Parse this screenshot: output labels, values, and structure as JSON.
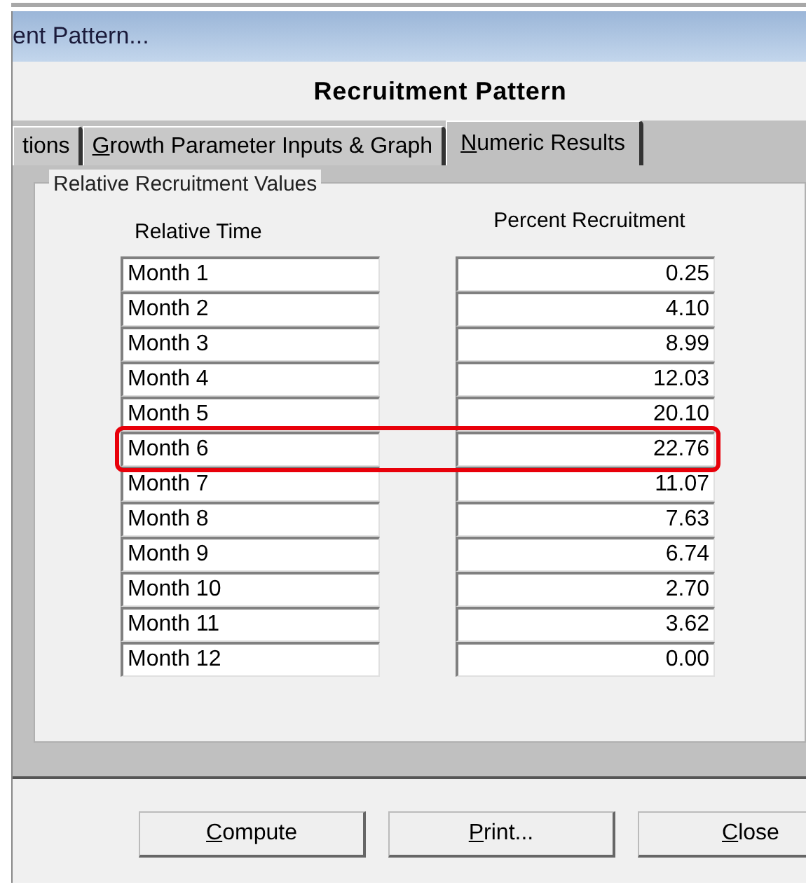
{
  "window": {
    "title": "ent Pattern..."
  },
  "header": "Recruitment Pattern",
  "tabs": [
    {
      "label": "tions",
      "selected": false,
      "underline_first": false
    },
    {
      "label": "Growth Parameter Inputs & Graph",
      "selected": false,
      "underline_first": true
    },
    {
      "label": "Numeric Results",
      "selected": true,
      "underline_first": true
    }
  ],
  "group": {
    "title": "Relative Recruitment Values",
    "column_1": "Relative Time",
    "column_2": "Percent Recruitment",
    "rows": [
      {
        "time": "Month 1",
        "percent": "0.25",
        "highlighted": false
      },
      {
        "time": "Month 2",
        "percent": "4.10",
        "highlighted": false
      },
      {
        "time": "Month 3",
        "percent": "8.99",
        "highlighted": false
      },
      {
        "time": "Month 4",
        "percent": "12.03",
        "highlighted": false
      },
      {
        "time": "Month 5",
        "percent": "20.10",
        "highlighted": false
      },
      {
        "time": "Month 6",
        "percent": "22.76",
        "highlighted": true
      },
      {
        "time": "Month 7",
        "percent": "11.07",
        "highlighted": false
      },
      {
        "time": "Month 8",
        "percent": "7.63",
        "highlighted": false
      },
      {
        "time": "Month 9",
        "percent": "6.74",
        "highlighted": false
      },
      {
        "time": "Month 10",
        "percent": "2.70",
        "highlighted": false
      },
      {
        "time": "Month 11",
        "percent": "3.62",
        "highlighted": false
      },
      {
        "time": "Month 12",
        "percent": "0.00",
        "highlighted": false
      }
    ]
  },
  "buttons": [
    {
      "label": "Compute",
      "underline_first": true
    },
    {
      "label": "Print...",
      "underline_first": true
    },
    {
      "label": "Close",
      "underline_first": true
    }
  ]
}
